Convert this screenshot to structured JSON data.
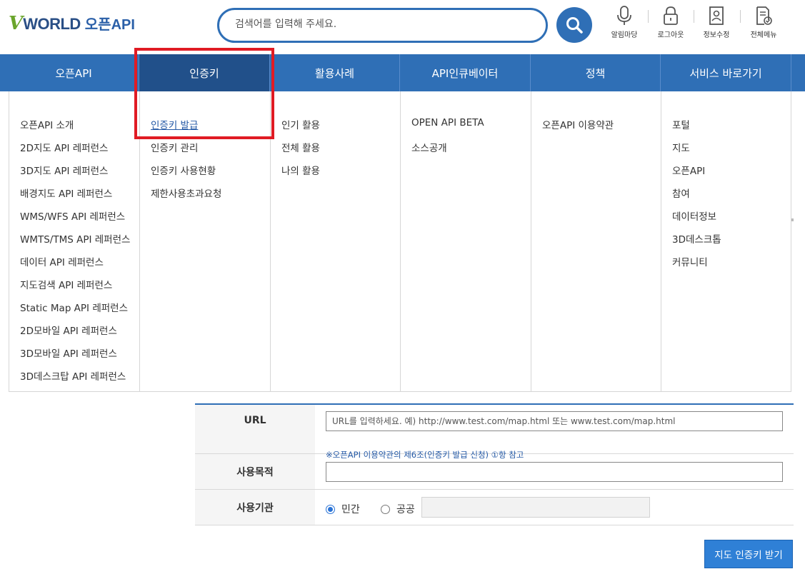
{
  "header": {
    "logo_v": "V",
    "logo_world": "WORLD",
    "logo_openapi": "오픈API",
    "search_placeholder": "검색어를 입력해 주세요.",
    "utilities": [
      {
        "label": "알림마당",
        "icon": "microphone-icon"
      },
      {
        "label": "로그아웃",
        "icon": "lock-icon"
      },
      {
        "label": "정보수정",
        "icon": "user-card-icon"
      },
      {
        "label": "전체메뉴",
        "icon": "document-check-icon"
      }
    ]
  },
  "nav": {
    "items": [
      {
        "label": "오픈API"
      },
      {
        "label": "인증키"
      },
      {
        "label": "활용사례"
      },
      {
        "label": "API인큐베이터"
      },
      {
        "label": "정책"
      },
      {
        "label": "서비스 바로가기"
      }
    ],
    "active_index": 1
  },
  "mega_menu": {
    "columns": [
      {
        "items": [
          "오픈API 소개",
          "2D지도 API 레퍼런스",
          "3D지도 API 레퍼런스",
          "배경지도 API 레퍼런스",
          "WMS/WFS API 레퍼런스",
          "WMTS/TMS API 레퍼런스",
          "데이터 API 레퍼런스",
          "지도검색 API 레퍼런스",
          "Static Map API 레퍼런스",
          "2D모바일 API 레퍼런스",
          "3D모바일 API 레퍼런스",
          "3D데스크탑 API 레퍼런스"
        ]
      },
      {
        "items": [
          "인증키 발급",
          "인증키 관리",
          "인증키 사용현황",
          "제한사용초과요청"
        ],
        "selected_index": 0
      },
      {
        "items": [
          "인기 활용",
          "전체 활용",
          "나의 활용"
        ]
      },
      {
        "items": [
          "OPEN API BETA",
          "소스공개"
        ]
      },
      {
        "items": [
          "오픈API 이용약관"
        ]
      },
      {
        "items": [
          "포털",
          "지도",
          "오픈API",
          "참여",
          "데이터정보",
          "3D데스크톱",
          "커뮤니티"
        ]
      }
    ]
  },
  "form": {
    "url_label": "URL",
    "url_placeholder": "URL를 입력하세요. 예) http://www.test.com/map.html 또는 www.test.com/map.html",
    "url_hint": "※오픈API 이용약관의 제6조(인증키 발급 신청) ①항 참고",
    "purpose_label": "사용목적",
    "purpose_value": "",
    "org_label": "사용기관",
    "org_options": [
      "민간",
      "공공"
    ],
    "org_selected": "민간",
    "org_input_value": "",
    "submit_label": "지도 인증키 받기"
  },
  "colors": {
    "nav_bg": "#2f6fb6",
    "nav_active_bg": "#21508a",
    "highlight_box": "#e01b24",
    "link_blue": "#2459a6",
    "submit_bg": "#2f80d6"
  }
}
